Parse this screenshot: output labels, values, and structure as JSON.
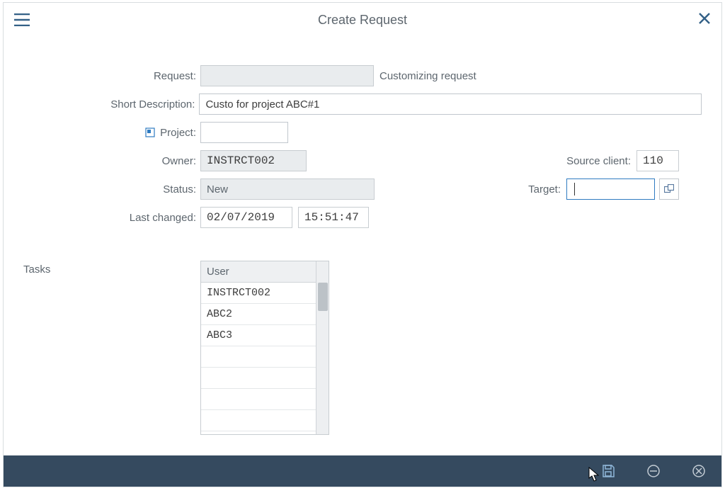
{
  "header": {
    "title": "Create Request"
  },
  "form": {
    "request": {
      "label": "Request:",
      "type_text": "Customizing request",
      "value": ""
    },
    "short_desc": {
      "label": "Short Description:",
      "value": "Custo for project ABC#1"
    },
    "project": {
      "label": "Project:",
      "value": ""
    },
    "owner": {
      "label": "Owner:",
      "value": "INSTRCT002"
    },
    "source_client": {
      "label": "Source client:",
      "value": "110"
    },
    "status": {
      "label": "Status:",
      "value": "New"
    },
    "target": {
      "label": "Target:",
      "value": ""
    },
    "last_changed": {
      "label": "Last changed:",
      "date": "02/07/2019",
      "time": "15:51:47"
    }
  },
  "tasks": {
    "label": "Tasks",
    "header": "User",
    "rows": [
      "INSTRCT002",
      "ABC2",
      "ABC3",
      "",
      "",
      "",
      ""
    ]
  }
}
